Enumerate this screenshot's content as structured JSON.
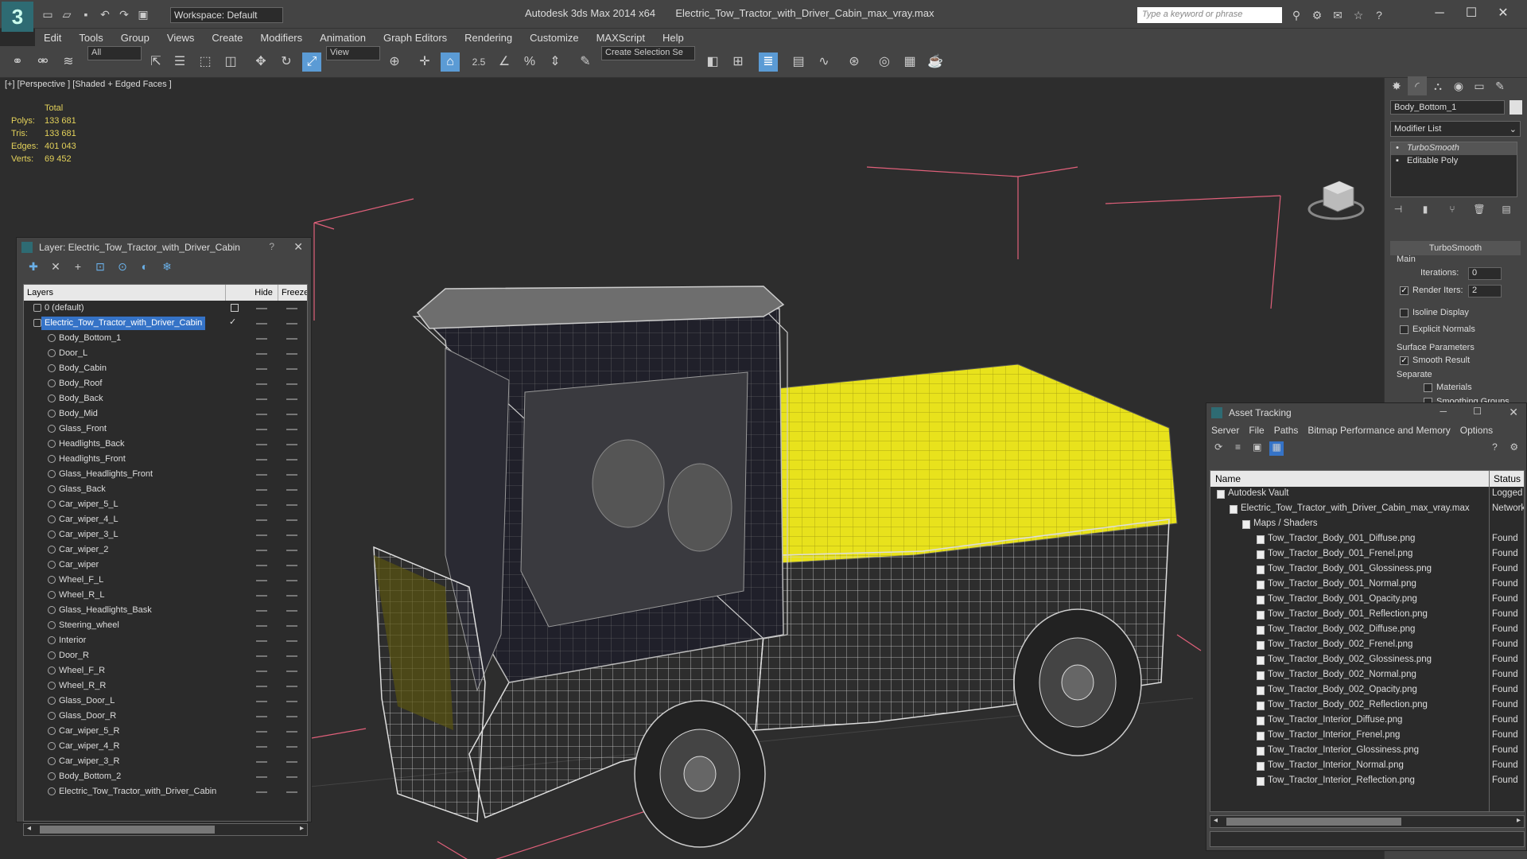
{
  "app": {
    "title": "Autodesk 3ds Max  2014 x64",
    "file": "Electric_Tow_Tractor_with_Driver_Cabin_max_vray.max",
    "logo": "3",
    "workspace": "Workspace: Default",
    "search_placeholder": "Type a keyword or phrase"
  },
  "menu": [
    "Edit",
    "Tools",
    "Group",
    "Views",
    "Create",
    "Modifiers",
    "Animation",
    "Graph Editors",
    "Rendering",
    "Customize",
    "MAXScript",
    "Help"
  ],
  "toolbar": {
    "filter": "All",
    "refcoord": "View",
    "selection_set": "Create Selection Se",
    "snap_value": "2.5"
  },
  "viewport": {
    "label": "[+] [Perspective ] [Shaded + Edged Faces ]",
    "stats": {
      "header": "Total",
      "polys_label": "Polys:",
      "polys": "133 681",
      "tris_label": "Tris:",
      "tris": "133 681",
      "edges_label": "Edges:",
      "edges": "401 043",
      "verts_label": "Verts:",
      "verts": "69 452"
    },
    "colors": {
      "wire": "#cfcfcf",
      "body": "#e8e21c",
      "dark": "#1d1d24",
      "bbox": "#e0607a"
    }
  },
  "command_panel": {
    "object_name": "Body_Bottom_1",
    "modifier_list": "Modifier List",
    "stack": [
      "TurboSmooth",
      "Editable Poly"
    ],
    "rollout_title": "TurboSmooth",
    "main_label": "Main",
    "iterations_label": "Iterations:",
    "iterations": "0",
    "render_iters_label": "Render Iters:",
    "render_iters": "2",
    "isoline": "Isoline Display",
    "explicit_normals": "Explicit Normals",
    "surface_params": "Surface Parameters",
    "smooth_result": "Smooth Result",
    "separate": "Separate",
    "materials": "Materials",
    "smoothing_groups": "Smoothing Groups"
  },
  "layers_panel": {
    "title": "Layer: Electric_Tow_Tractor_with_Driver_Cabin",
    "help": "?",
    "headers": {
      "layers": "Layers",
      "hide": "Hide",
      "freeze": "Freeze"
    },
    "layers": [
      {
        "name": "0 (default)",
        "level": 1
      },
      {
        "name": "Electric_Tow_Tractor_with_Driver_Cabin",
        "level": 1,
        "selected": true
      }
    ],
    "objects": [
      "Body_Bottom_1",
      "Door_L",
      "Body_Cabin",
      "Body_Roof",
      "Body_Back",
      "Body_Mid",
      "Glass_Front",
      "Headlights_Back",
      "Headlights_Front",
      "Glass_Headlights_Front",
      "Glass_Back",
      "Car_wiper_5_L",
      "Car_wiper_4_L",
      "Car_wiper_3_L",
      "Car_wiper_2",
      "Car_wiper",
      "Wheel_F_L",
      "Wheel_R_L",
      "Glass_Headlights_Bask",
      "Steering_wheel",
      "Interior",
      "Door_R",
      "Wheel_F_R",
      "Wheel_R_R",
      "Glass_Door_L",
      "Glass_Door_R",
      "Car_wiper_5_R",
      "Car_wiper_4_R",
      "Car_wiper_3_R",
      "Body_Bottom_2",
      "Electric_Tow_Tractor_with_Driver_Cabin"
    ]
  },
  "asset_panel": {
    "title": "Asset Tracking",
    "menu": [
      "Server",
      "File",
      "Paths",
      "Bitmap Performance and Memory",
      "Options"
    ],
    "headers": {
      "name": "Name",
      "status": "Status"
    },
    "rows": [
      {
        "name": "Autodesk Vault",
        "status": "Logged",
        "indent": 0
      },
      {
        "name": "Electric_Tow_Tractor_with_Driver_Cabin_max_vray.max",
        "status": "Network",
        "indent": 1
      },
      {
        "name": "Maps / Shaders",
        "status": "",
        "indent": 2
      },
      {
        "name": "Tow_Tractor_Body_001_Diffuse.png",
        "status": "Found",
        "indent": 3
      },
      {
        "name": "Tow_Tractor_Body_001_Frenel.png",
        "status": "Found",
        "indent": 3
      },
      {
        "name": "Tow_Tractor_Body_001_Glossiness.png",
        "status": "Found",
        "indent": 3
      },
      {
        "name": "Tow_Tractor_Body_001_Normal.png",
        "status": "Found",
        "indent": 3
      },
      {
        "name": "Tow_Tractor_Body_001_Opacity.png",
        "status": "Found",
        "indent": 3
      },
      {
        "name": "Tow_Tractor_Body_001_Reflection.png",
        "status": "Found",
        "indent": 3
      },
      {
        "name": "Tow_Tractor_Body_002_Diffuse.png",
        "status": "Found",
        "indent": 3
      },
      {
        "name": "Tow_Tractor_Body_002_Frenel.png",
        "status": "Found",
        "indent": 3
      },
      {
        "name": "Tow_Tractor_Body_002_Glossiness.png",
        "status": "Found",
        "indent": 3
      },
      {
        "name": "Tow_Tractor_Body_002_Normal.png",
        "status": "Found",
        "indent": 3
      },
      {
        "name": "Tow_Tractor_Body_002_Opacity.png",
        "status": "Found",
        "indent": 3
      },
      {
        "name": "Tow_Tractor_Body_002_Reflection.png",
        "status": "Found",
        "indent": 3
      },
      {
        "name": "Tow_Tractor_Interior_Diffuse.png",
        "status": "Found",
        "indent": 3
      },
      {
        "name": "Tow_Tractor_Interior_Frenel.png",
        "status": "Found",
        "indent": 3
      },
      {
        "name": "Tow_Tractor_Interior_Glossiness.png",
        "status": "Found",
        "indent": 3
      },
      {
        "name": "Tow_Tractor_Interior_Normal.png",
        "status": "Found",
        "indent": 3
      },
      {
        "name": "Tow_Tractor_Interior_Reflection.png",
        "status": "Found",
        "indent": 3
      }
    ]
  }
}
